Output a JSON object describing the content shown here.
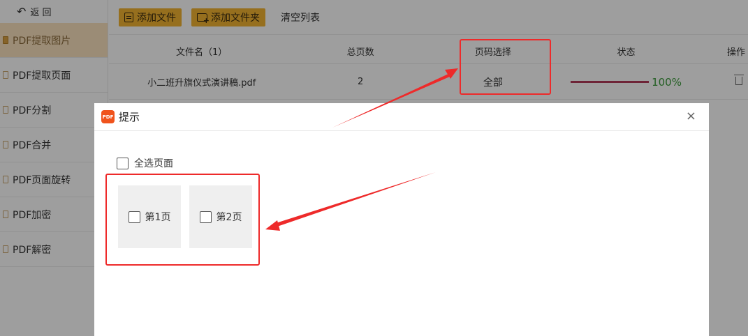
{
  "sidebar": {
    "back_label": "返  回",
    "items": [
      {
        "label": "PDF提取图片",
        "active": true
      },
      {
        "label": "PDF提取页面",
        "active": false
      },
      {
        "label": "PDF分割",
        "active": false
      },
      {
        "label": "PDF合并",
        "active": false
      },
      {
        "label": "PDF页面旋转",
        "active": false
      },
      {
        "label": "PDF加密",
        "active": false
      },
      {
        "label": "PDF解密",
        "active": false
      }
    ]
  },
  "toolbar": {
    "add_file_label": "添加文件",
    "add_folder_label": "添加文件夹",
    "clear_label": "清空列表"
  },
  "table": {
    "headers": [
      "文件名（1）",
      "总页数",
      "页码选择",
      "状态",
      "操作"
    ],
    "rows": [
      {
        "filename": "小二班升旗仪式演讲稿.pdf",
        "total_pages": "2",
        "page_selection": "全部",
        "progress": 1.0,
        "progress_text": "100%"
      }
    ]
  },
  "dialog": {
    "title": "提示",
    "close_glyph": "×",
    "app_icon_text": "PDF",
    "select_all_label": "全选页面",
    "pages": [
      {
        "label": "第1页",
        "checked": false
      },
      {
        "label": "第2页",
        "checked": false
      }
    ]
  },
  "colors": {
    "accent": "#f2b431",
    "sidebar_active": "#fbe3bf",
    "progress_fill": "#b23a5a",
    "progress_text": "#3a9a3a",
    "annotation": "#ee2a2a",
    "app_icon": "#f0531c"
  }
}
